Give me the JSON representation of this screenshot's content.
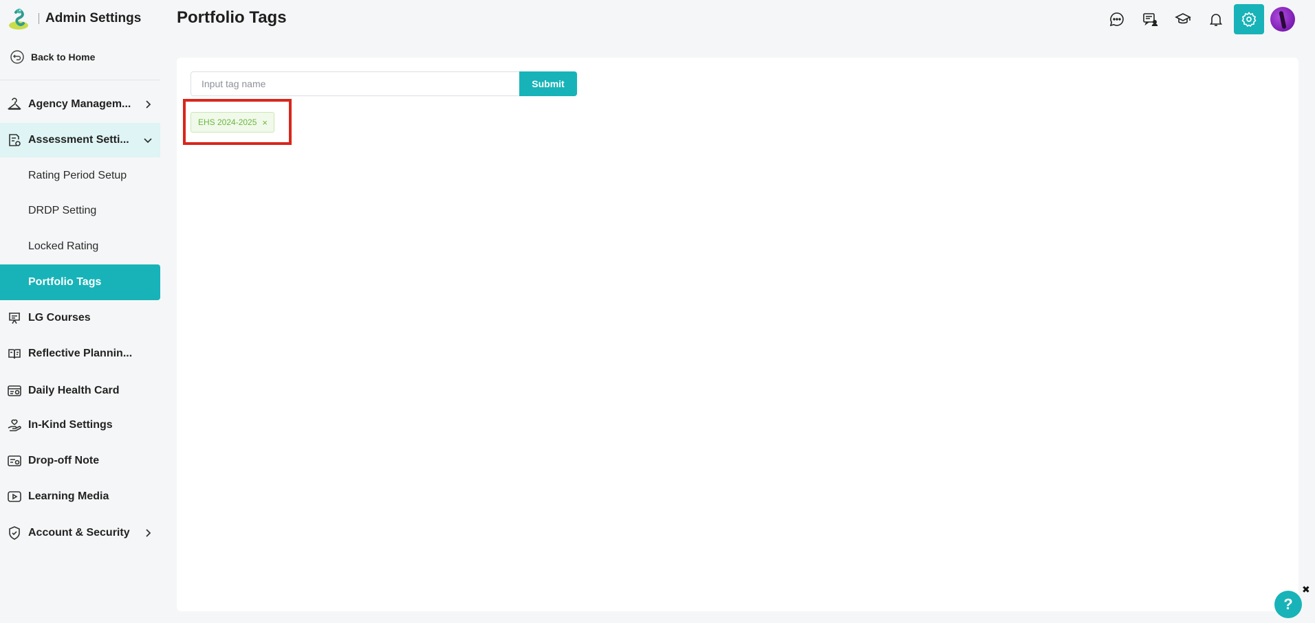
{
  "app": {
    "title": "Admin Settings"
  },
  "sidebar": {
    "back_label": "Back to Home",
    "items": [
      {
        "label": "Agency Managem...",
        "icon": "hanger-icon",
        "chevron": "right"
      },
      {
        "label": "Assessment Setti...",
        "icon": "assessment-icon",
        "chevron": "down",
        "children": [
          {
            "label": "Rating Period Setup"
          },
          {
            "label": "DRDP Setting"
          },
          {
            "label": "Locked Rating"
          },
          {
            "label": "Portfolio Tags",
            "active": true
          }
        ]
      },
      {
        "label": "LG Courses",
        "icon": "presentation-icon"
      },
      {
        "label": "Reflective Plannin...",
        "icon": "book-icon"
      },
      {
        "label": "Daily Health Card",
        "icon": "health-card-icon"
      },
      {
        "label": "In-Kind Settings",
        "icon": "hand-heart-icon"
      },
      {
        "label": "Drop-off Note",
        "icon": "note-icon"
      },
      {
        "label": "Learning Media",
        "icon": "play-icon"
      },
      {
        "label": "Account & Security",
        "icon": "shield-icon",
        "chevron": "right"
      }
    ]
  },
  "header": {
    "page_title": "Portfolio Tags",
    "icons": [
      "chat-icon",
      "message-board-icon",
      "graduation-cap-icon",
      "bell-icon",
      "gear-icon",
      "avatar"
    ]
  },
  "main": {
    "tag_input": {
      "placeholder": "Input tag name",
      "value": ""
    },
    "submit_label": "Submit",
    "tags": [
      {
        "label": "EHS 2024-2025",
        "remove": "×"
      }
    ]
  },
  "help": {
    "label": "?",
    "close": "✖"
  },
  "colors": {
    "accent": "#17b3b8",
    "tag_green": "#68b83d",
    "highlight_red": "#d9261c"
  }
}
